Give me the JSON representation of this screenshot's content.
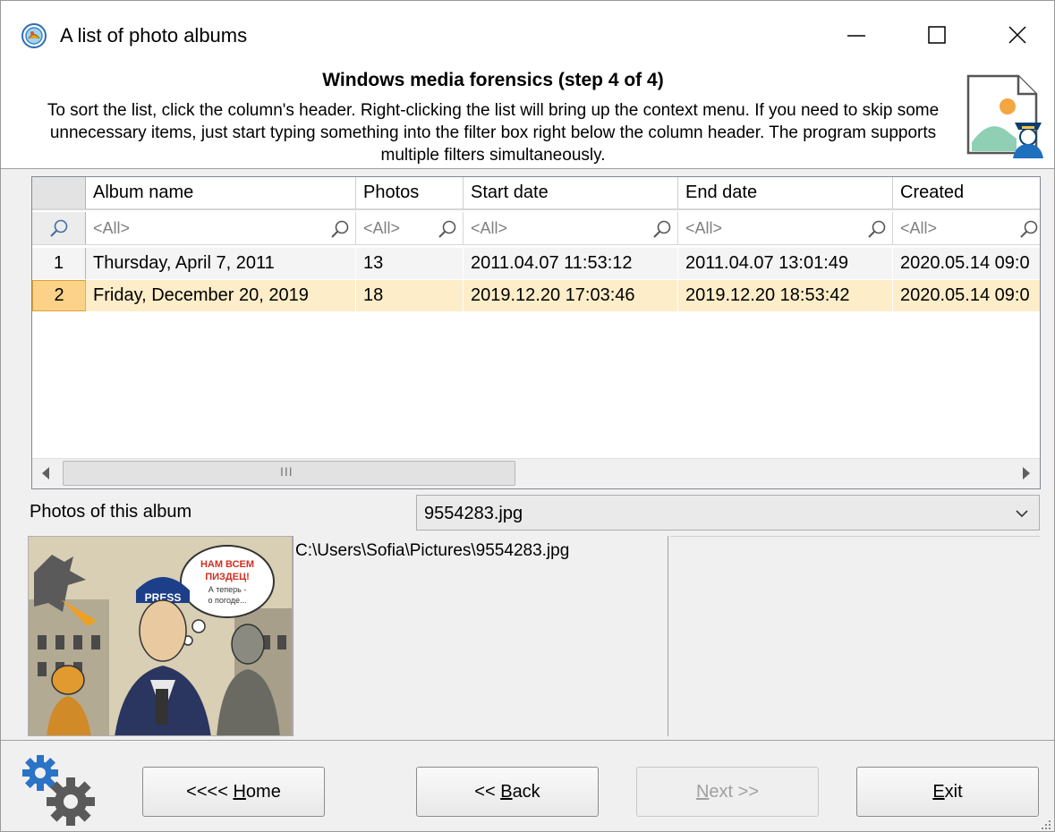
{
  "window": {
    "title": "A list of photo albums"
  },
  "header": {
    "title": "Windows media forensics (step 4 of 4)",
    "description": "To sort the list, click the column's header. Right-clicking the list will bring up the context menu. If you need to skip some unnecessary items, just start typing something into the filter box right below the column header. The program supports multiple filters simultaneously."
  },
  "grid": {
    "columns": [
      "Album name",
      "Photos",
      "Start date",
      "End date",
      "Created"
    ],
    "filter_placeholder": "<All>",
    "rows": [
      {
        "num": "1",
        "album": "Thursday, April 7, 2011",
        "photos": "13",
        "start": "2011.04.07 11:53:12",
        "end": "2011.04.07 13:01:49",
        "created": "2020.05.14 09:0"
      },
      {
        "num": "2",
        "album": "Friday, December 20, 2019",
        "photos": "18",
        "start": "2019.12.20 17:03:46",
        "end": "2019.12.20 18:53:42",
        "created": "2020.05.14 09:0"
      }
    ],
    "selected_row": 2,
    "scroll_grip": "III"
  },
  "photos": {
    "label": "Photos of this album",
    "selected_file": "9554283.jpg",
    "path": "C:\\Users\\Sofia\\Pictures\\9554283.jpg",
    "image_caption_lines": [
      "НАМ ВСЕМ",
      "ПИЗДЕЦ!",
      "А теперь -",
      "о погоде..."
    ],
    "image_badge": "PRESS"
  },
  "footer": {
    "home_prefix": "<<<< ",
    "home_key": "H",
    "home_rest": "ome",
    "back_prefix": "<< ",
    "back_key": "B",
    "back_rest": "ack",
    "next_key": "N",
    "next_rest": "ext >>",
    "exit_key": "E",
    "exit_rest": "xit"
  },
  "colors": {
    "selected_row": "#fdedc9",
    "selected_indicator": "#fcd289",
    "accent_blue": "#2e7bbf"
  }
}
